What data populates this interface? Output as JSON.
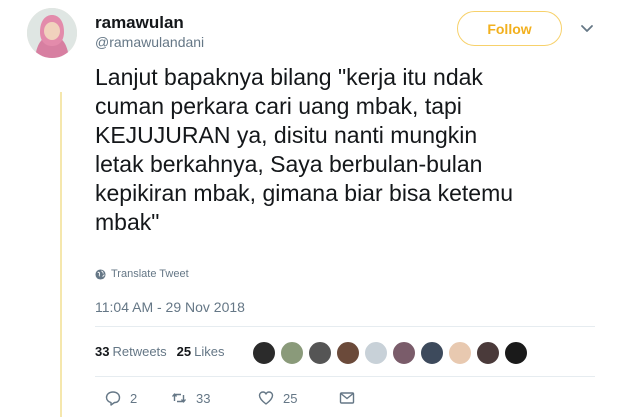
{
  "user": {
    "display_name": "ramawulan",
    "handle": "@ramawulandani"
  },
  "follow_label": "Follow",
  "tweet": {
    "text": "Lanjut bapaknya bilang \"kerja itu ndak\ncuman perkara cari uang mbak, tapi\nKEJUJURAN ya, disitu nanti mungkin\nletak berkahnya, Saya berbulan-bulan\nkepikiran mbak, gimana biar bisa ketemu\nmbak\""
  },
  "translate_label": "Translate Tweet",
  "timestamp": "11:04 AM - 29 Nov 2018",
  "stats": {
    "retweets_count": "33",
    "retweets_label": "Retweets",
    "likes_count": "25",
    "likes_label": "Likes"
  },
  "liker_avatar_colors": [
    "#2b2b2b",
    "#8a9a7a",
    "#555555",
    "#6b4a3a",
    "#c8d1d8",
    "#7a5c6a",
    "#3d4a5c",
    "#e8c9b0",
    "#4a3a3a",
    "#1a1a1a"
  ],
  "actions": {
    "reply_count": "2",
    "retweet_count": "33",
    "like_count": "25"
  },
  "colors": {
    "accent": "#f2b01e",
    "thread_line": "#f5e7ad",
    "muted": "#657786"
  }
}
